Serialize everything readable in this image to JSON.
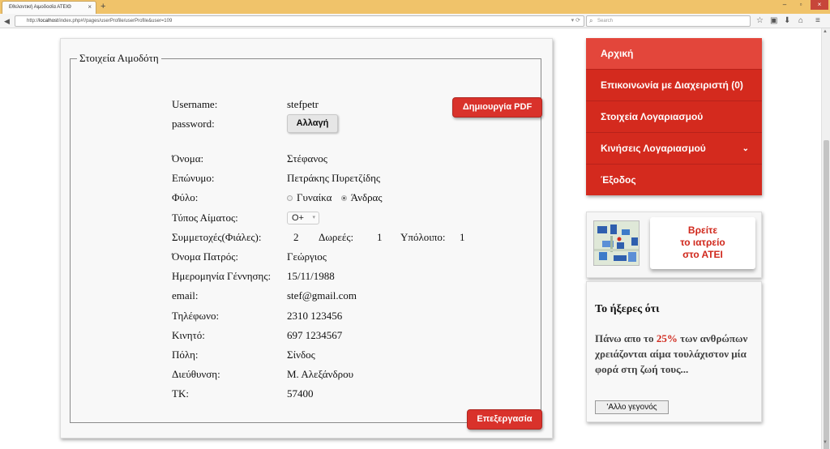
{
  "browser": {
    "tab_title": "Εθελοντική Αιμοδοσία ΑΤΕΙΘ",
    "tab_close": "×",
    "new_tab": "+",
    "url_prefix": "http://",
    "url_host": "localhost",
    "url_path": "/index.php#!/pages/userProfile/userProfile&user=109",
    "search_placeholder": "Search"
  },
  "panel": {
    "legend": "Στοιχεία Αιμοδότη",
    "create_pdf": "Δημιουργία PDF",
    "edit": "Επεξεργασία",
    "change_password": "Αλλαγή"
  },
  "profile": {
    "username_label": "Username:",
    "username": "stefpetr",
    "password_label": "password:",
    "first_name_label": "Όνομα:",
    "first_name": "Στέφανος",
    "last_name_label": "Επώνυμο:",
    "last_name": "Πετράκης Πυρετζίδης",
    "gender_label": "Φύλο:",
    "gender_female": "Γυναίκα",
    "gender_male": "Άνδρας",
    "gender_selected": "male",
    "blood_type_label": "Τύπος Αίματος:",
    "blood_type": "O+",
    "participations_label": "Συμμετοχές(Φιάλες):",
    "participations": "2",
    "donations_label": "Δωρεές:",
    "donations": "1",
    "balance_label": "Υπόλοιπο:",
    "balance": "1",
    "father_name_label": "Όνομα Πατρός:",
    "father_name": "Γεώργιος",
    "birth_date_label": "Ημερομηνία Γέννησης:",
    "birth_date": "15/11/1988",
    "email_label": "email:",
    "email": "stef@gmail.com",
    "phone_label": "Τηλέφωνο:",
    "phone": "2310 123456",
    "mobile_label": "Κινητό:",
    "mobile": "697 1234567",
    "city_label": "Πόλη:",
    "city": "Σίνδος",
    "address_label": "Διεύθυνση:",
    "address": "Μ. Αλεξάνδρου",
    "zip_label": "ΤΚ:",
    "zip": "57400"
  },
  "menu": {
    "items": [
      {
        "label": "Αρχική"
      },
      {
        "label": "Επικοινωνία με Διαχειριστή (0)"
      },
      {
        "label": "Στοιχεία Λογαριασμού"
      },
      {
        "label": "Κινήσεις Λογαριασμού"
      },
      {
        "label": "Έξοδος"
      }
    ]
  },
  "promo": {
    "line1": "Βρείτε",
    "line2": "το ιατρείο",
    "line3": "στο ΑΤΕΙ"
  },
  "facts": {
    "title": "Το ήξερες ότι",
    "text_before": "Πάνω απο το ",
    "highlight": "25%",
    "text_after": " των ανθρώπων χρειάζονται αίμα τουλάχιστον μία φορά στη ζωή τους...",
    "button": "'Αλλο γεγονός"
  },
  "colors": {
    "brand_red": "#d42a1e",
    "tabbar": "#f0c36a"
  }
}
